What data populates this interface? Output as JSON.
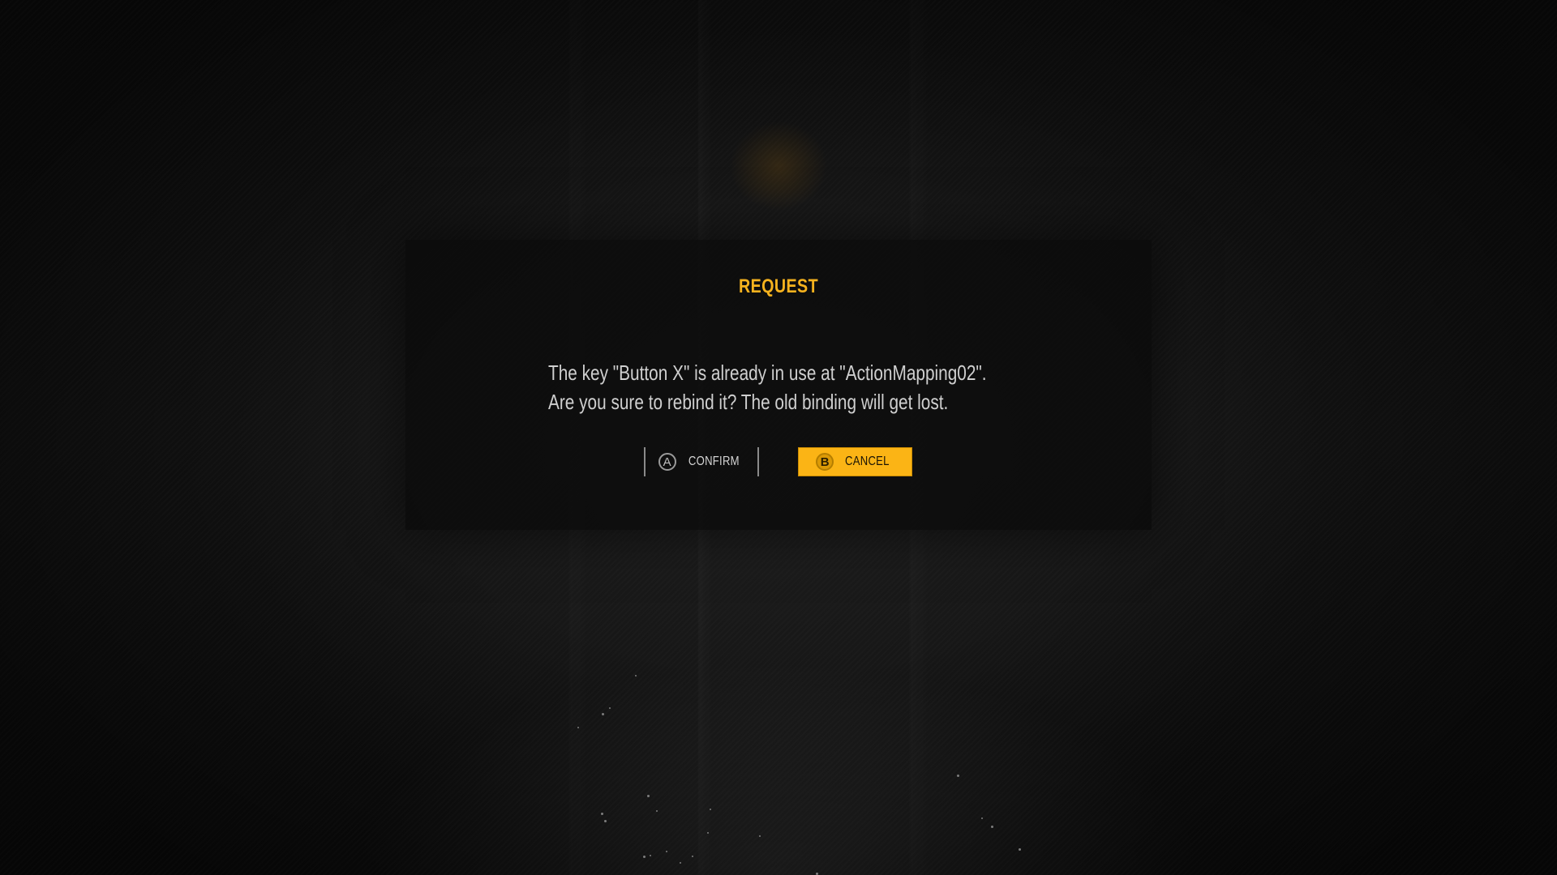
{
  "dialog": {
    "title": "REQUEST",
    "message_line1": "The key \"Button X\" is already in use at \"ActionMapping02\".",
    "message_line2": "Are you sure to rebind it? The old binding will get lost."
  },
  "buttons": {
    "confirm": {
      "glyph": "A",
      "label": "CONFIRM",
      "icon": "controller-a-button-icon"
    },
    "cancel": {
      "glyph": "B",
      "label": "CANCEL",
      "icon": "controller-b-button-icon",
      "selected": true
    }
  },
  "colors": {
    "accent": "#f5b21e",
    "cancel_bg": "#fbb415",
    "text": "#cfcfcf",
    "background": "#0c0c0c"
  }
}
